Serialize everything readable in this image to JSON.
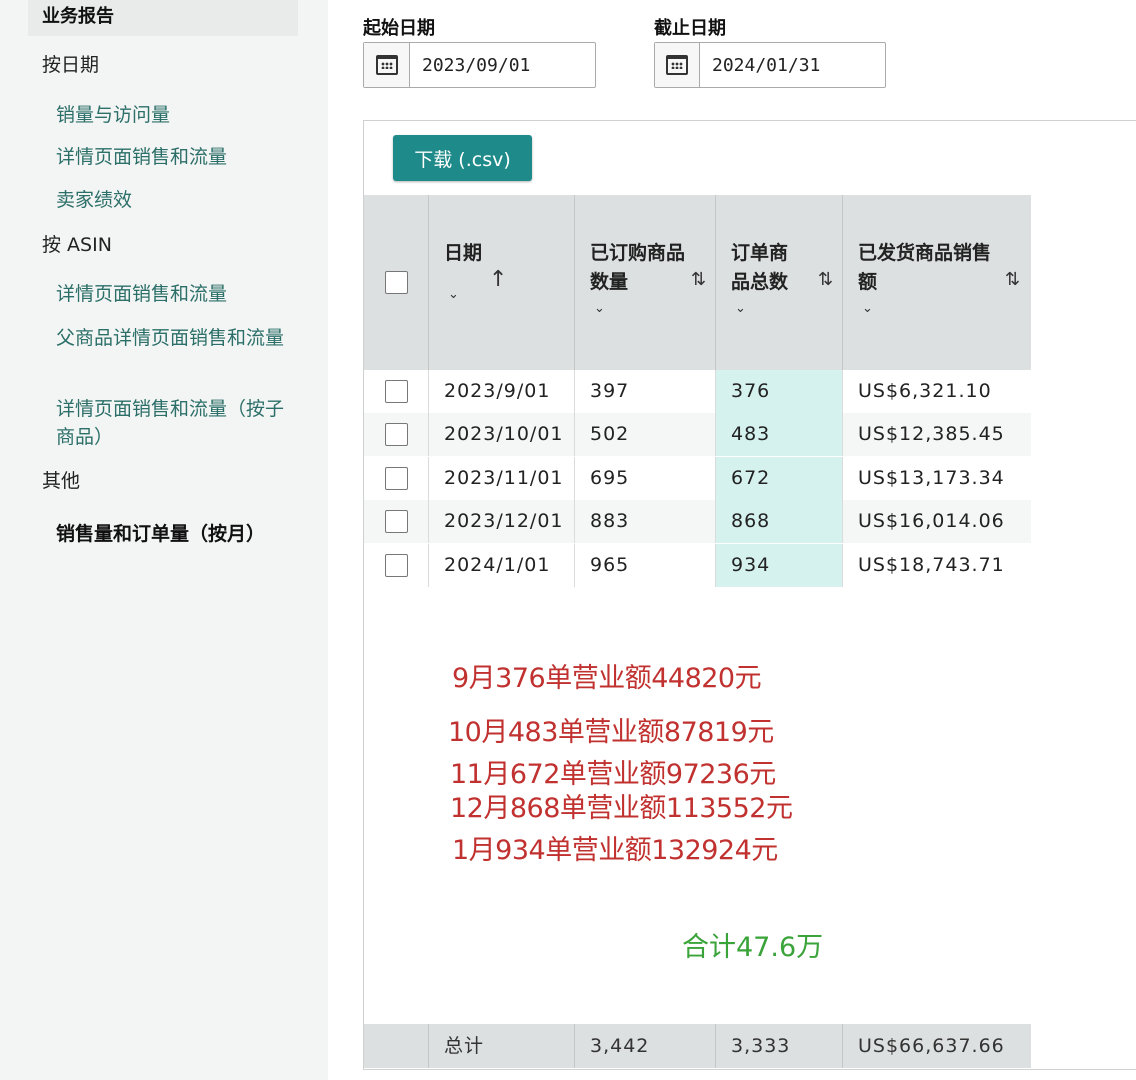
{
  "sidebar": {
    "header": "业务报告",
    "groups": {
      "by_date": "按日期",
      "by_asin": "按 ASIN",
      "other": "其他"
    },
    "by_date_links": [
      "销量与访问量",
      "详情页面销售和流量",
      "卖家绩效"
    ],
    "by_asin_links": [
      "详情页面销售和流量",
      "父商品详情页面销售和流量",
      "详情页面销售和流量（按子商品）"
    ],
    "active": "销售量和订单量（按月）"
  },
  "filters": {
    "start_label": "起始日期",
    "start_value": "2023/09/01",
    "end_label": "截止日期",
    "end_value": "2024/01/31"
  },
  "toolbar": {
    "download_label": "下载 (.csv)"
  },
  "table": {
    "columns": {
      "date": "日期",
      "units_ordered": "已订购商品数量",
      "total_order_items": "订单商品总数",
      "shipped_sales": "已发货商品销售额"
    },
    "rows": [
      {
        "date": "2023/9/01",
        "units": "397",
        "orders": "376",
        "sales": "US$6,321.10"
      },
      {
        "date": "2023/10/01",
        "units": "502",
        "orders": "483",
        "sales": "US$12,385.45"
      },
      {
        "date": "2023/11/01",
        "units": "695",
        "orders": "672",
        "sales": "US$13,173.34"
      },
      {
        "date": "2023/12/01",
        "units": "883",
        "orders": "868",
        "sales": "US$16,014.06"
      },
      {
        "date": "2024/1/01",
        "units": "965",
        "orders": "934",
        "sales": "US$18,743.71"
      }
    ],
    "total": {
      "label": "总计",
      "units": "3,442",
      "orders": "3,333",
      "sales": "US$66,637.66"
    }
  },
  "annotations": {
    "lines": [
      "9月376单营业额44820元",
      "10月483单营业额87819元",
      "11月672单营业额97236元",
      "12月868单营业额113552元",
      "1月934单营业额132924元"
    ],
    "sum": "合计47.6万"
  }
}
